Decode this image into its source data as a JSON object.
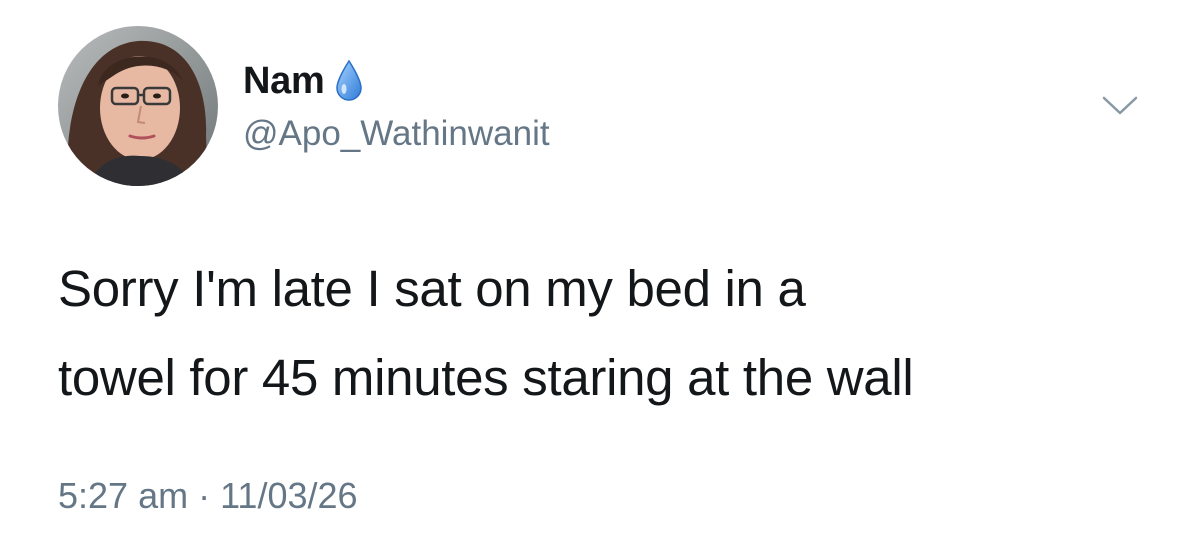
{
  "author": {
    "display_name": "Nam",
    "handle": "@Apo_Wathinwanit",
    "badge_icon": "water-droplet-icon",
    "avatar_icon": "profile-photo"
  },
  "tweet": {
    "text_lines": [
      "Sorry I'm late I sat on my bed in a",
      "towel for 45 minutes staring at the wall"
    ],
    "timestamp": "5:27 am · 11/03/26"
  },
  "menu": {
    "icon": "chevron-down-icon"
  },
  "colors": {
    "text_primary": "#14171a",
    "text_secondary": "#657786",
    "droplet_blue": "#4a90e2",
    "background": "#ffffff"
  }
}
